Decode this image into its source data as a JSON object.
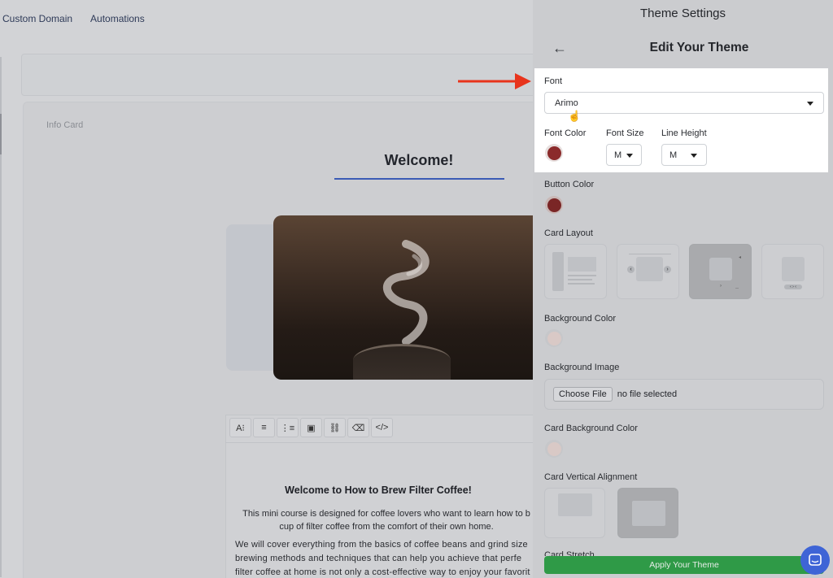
{
  "topnav": {
    "items": [
      "Custom Domain",
      "Automations"
    ]
  },
  "canvas": {
    "card_label": "Info Card",
    "welcome": "Welcome!",
    "toolbar": [
      "A⁝",
      "≡",
      "⋮≡",
      "▣",
      "⛓",
      "⌫",
      "</>"
    ],
    "content_title": "Welcome to How to Brew Filter Coffee!",
    "content_p1_line1": "This mini course is designed for coffee lovers who want to learn how to b",
    "content_p1_line2": "cup of filter coffee from the comfort of their own home.",
    "content_p2_line1": "We will cover everything from the basics of coffee beans and grind size",
    "content_p2_line2": "brewing methods and techniques that can help you achieve that perfe",
    "content_p2_line3": "filter coffee at home is not only a cost-effective way to enjoy your favorit"
  },
  "panel": {
    "title": "Theme Settings",
    "subtitle": "Edit Your Theme",
    "font_label": "Font",
    "font_value": "Arimo",
    "font_color_label": "Font Color",
    "font_size_label": "Font Size",
    "font_size_value": "M",
    "line_height_label": "Line Height",
    "line_height_value": "M",
    "button_color_label": "Button Color",
    "card_layout_label": "Card Layout",
    "background_color_label": "Background Color",
    "background_image_label": "Background Image",
    "choose_file": "Choose File",
    "no_file": "no file selected",
    "card_bg_color_label": "Card Background Color",
    "card_vertical_alignment_label": "Card Vertical Alignment",
    "card_stretch_label": "Card Stretch",
    "apply_label": "Apply Your Theme"
  },
  "colors": {
    "font_color": "#8b2b2b",
    "button_color": "#7a2626",
    "background_color": "#d9c9c6",
    "card_background_color": "#d9c9c6",
    "apply": "#2f9a47",
    "arrow": "#e8341c",
    "chat": "#3e64d6"
  },
  "icons": {
    "back": "arrow-left-icon",
    "chat": "chat-icon",
    "cursor": "hand-pointer-icon"
  }
}
